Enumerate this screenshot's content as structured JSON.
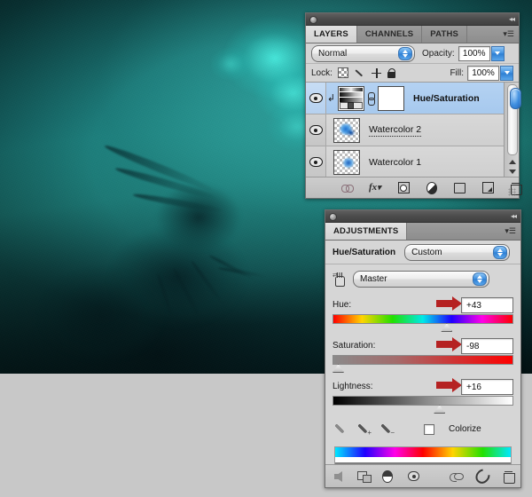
{
  "artwork": {
    "name": "underwater-teal-artwork",
    "dominant_color": "#1d8983",
    "shadow_color": "#052427",
    "glow_color": "#46f5e6"
  },
  "layers_panel": {
    "titlebar": {
      "collapse_label": "◂◂"
    },
    "tabs": [
      {
        "label": "LAYERS",
        "active": true
      },
      {
        "label": "CHANNELS",
        "active": false
      },
      {
        "label": "PATHS",
        "active": false
      }
    ],
    "menu_icon": "panel-menu-icon",
    "blend_mode": {
      "label": "",
      "value": "Normal"
    },
    "opacity": {
      "label": "Opacity:",
      "value": "100%"
    },
    "lock": {
      "label": "Lock:",
      "icons": [
        "lock-transparency-icon",
        "lock-image-icon",
        "lock-position-icon",
        "lock-all-icon"
      ]
    },
    "fill": {
      "label": "Fill:",
      "value": "100%"
    },
    "rows": [
      {
        "name": "Hue/Saturation",
        "selected": true,
        "visible": true,
        "clipped": true,
        "kind": "adjustment",
        "editing": false
      },
      {
        "name": "Watercolor 2",
        "selected": false,
        "visible": true,
        "clipped": false,
        "kind": "pixel",
        "editing": true
      },
      {
        "name": "Watercolor 1",
        "selected": false,
        "visible": true,
        "clipped": false,
        "kind": "pixel",
        "editing": false
      }
    ],
    "scrollbar": {
      "name": "layers-scrollbar",
      "thumb_position": "top"
    },
    "footer_icons": [
      "link-layers-icon",
      "layer-styles-fx-icon",
      "add-layer-mask-icon",
      "new-adjustment-layer-icon",
      "new-group-icon",
      "new-layer-icon",
      "delete-layer-icon"
    ]
  },
  "adjustments_panel": {
    "titlebar": {
      "collapse_label": "◂◂"
    },
    "tabs": [
      {
        "label": "ADJUSTMENTS",
        "active": true
      }
    ],
    "menu_icon": "panel-menu-icon",
    "adjustment_title": "Hue/Saturation",
    "preset": {
      "value": "Custom"
    },
    "targeted_adjust_icon": "on-image-adjust-hand-icon",
    "channel": {
      "value": "Master"
    },
    "sliders": [
      {
        "label": "Hue:",
        "value": "+43",
        "numeric": 43,
        "min": -180,
        "max": 180,
        "track": "hue",
        "knob_percent": 62,
        "annotated": true
      },
      {
        "label": "Saturation:",
        "value": "-98",
        "numeric": -98,
        "min": -100,
        "max": 100,
        "track": "sat",
        "knob_percent": 1,
        "annotated": true
      },
      {
        "label": "Lightness:",
        "value": "+16",
        "numeric": 16,
        "min": -100,
        "max": 100,
        "track": "light",
        "knob_percent": 58,
        "annotated": true
      }
    ],
    "eyedroppers": [
      "eyedropper-icon",
      "eyedropper-add-icon",
      "eyedropper-subtract-icon"
    ],
    "colorize": {
      "label": "Colorize",
      "checked": false
    },
    "spectrum": {
      "name": "hue-range-spectrum"
    },
    "footer_icons": [
      "return-to-adjustment-list-icon",
      "expand-panel-view-icon",
      "clip-to-layer-icon",
      "toggle-layer-visibility-icon",
      "preview-previous-state-icon",
      "reset-adjustment-icon",
      "delete-adjustment-icon"
    ]
  },
  "annotation": {
    "arrow_color": "#b52222",
    "count": 3
  }
}
